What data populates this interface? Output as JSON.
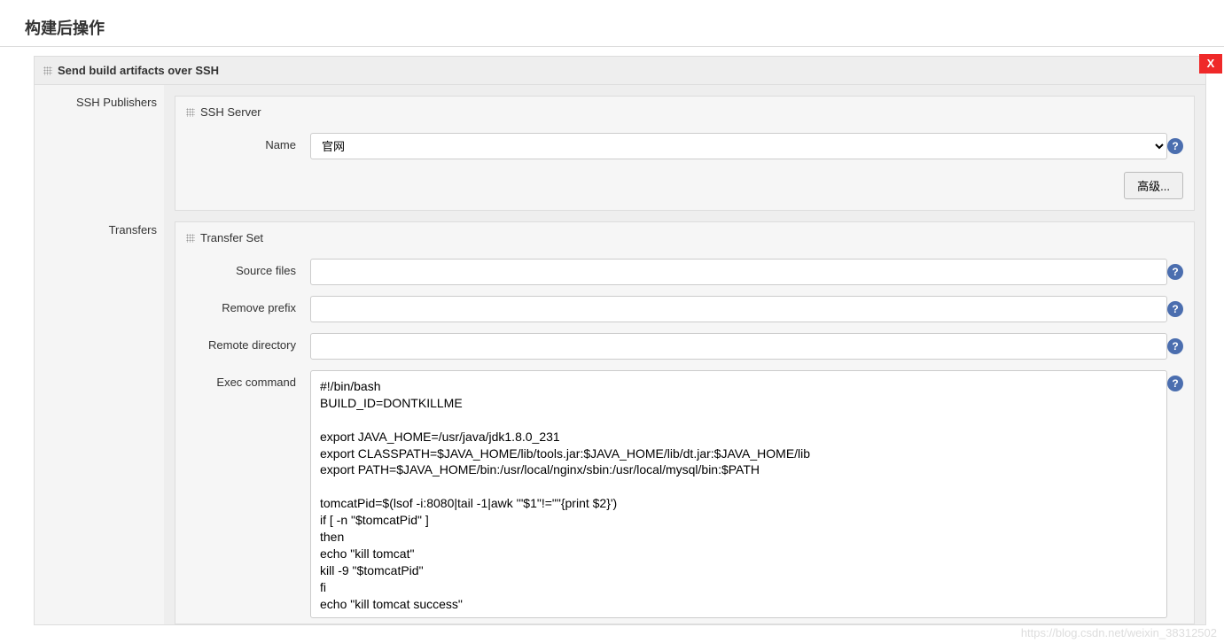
{
  "page": {
    "title": "构建后操作"
  },
  "section": {
    "title": "Send build artifacts over SSH",
    "close": "X",
    "sidebar": {
      "publishers_label": "SSH Publishers"
    }
  },
  "ssh_server": {
    "heading": "SSH Server",
    "name_label": "Name",
    "name_value": "官网",
    "advanced_btn": "高级..."
  },
  "transfers": {
    "label": "Transfers",
    "heading": "Transfer Set",
    "source_files_label": "Source files",
    "source_files_value": "",
    "remove_prefix_label": "Remove prefix",
    "remove_prefix_value": "",
    "remote_directory_label": "Remote directory",
    "remote_directory_value": "",
    "exec_command_label": "Exec command",
    "exec_command_value": "#!/bin/bash\nBUILD_ID=DONTKILLME\n\nexport JAVA_HOME=/usr/java/jdk1.8.0_231\nexport CLASSPATH=$JAVA_HOME/lib/tools.jar:$JAVA_HOME/lib/dt.jar:$JAVA_HOME/lib\nexport PATH=$JAVA_HOME/bin:/usr/local/nginx/sbin:/usr/local/mysql/bin:$PATH\n\ntomcatPid=$(lsof -i:8080|tail -1|awk '\"$1\"!=\"\"{print $2}')\nif [ -n \"$tomcatPid\" ]\nthen\necho \"kill tomcat\"\nkill -9 \"$tomcatPid\"\nfi\necho \"kill tomcat success\""
  },
  "help_glyph": "?",
  "watermark": "https://blog.csdn.net/weixin_38312502"
}
